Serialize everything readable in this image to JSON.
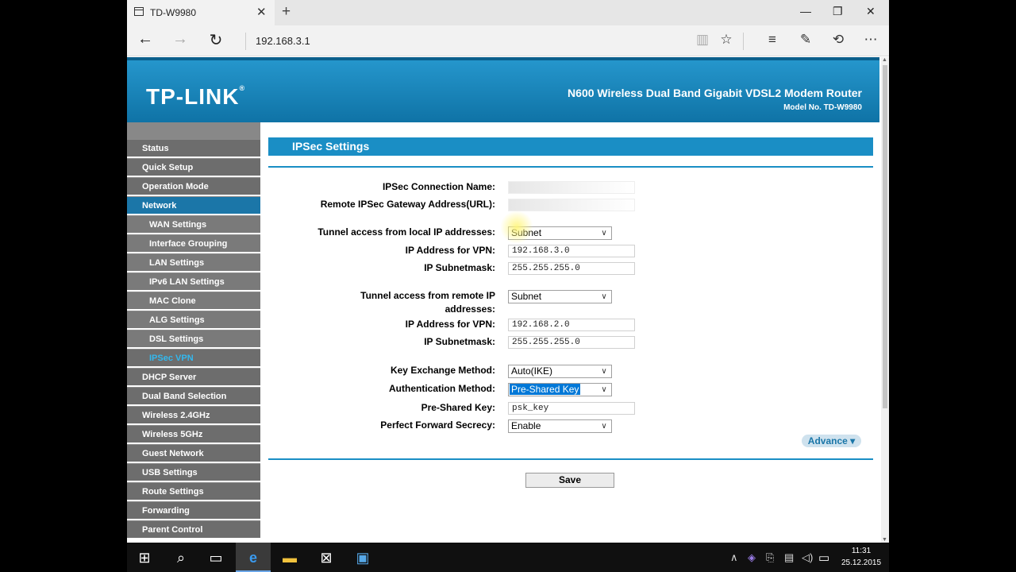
{
  "browser": {
    "tab_title": "TD-W9980",
    "tab_close": "✕",
    "new_tab": "+",
    "url": "192.168.3.1",
    "window_controls": {
      "minimize": "—",
      "maximize": "❐",
      "close": "✕"
    }
  },
  "router": {
    "logo": "TP-LINK",
    "logo_mark": "®",
    "product_name": "N600 Wireless Dual Band Gigabit VDSL2 Modem Router",
    "model": "Model No. TD-W9980"
  },
  "sidebar": {
    "items": [
      {
        "label": "Status"
      },
      {
        "label": "Quick Setup"
      },
      {
        "label": "Operation Mode"
      },
      {
        "label": "Network"
      },
      {
        "label": "WAN Settings"
      },
      {
        "label": "Interface Grouping"
      },
      {
        "label": "LAN Settings"
      },
      {
        "label": "IPv6 LAN Settings"
      },
      {
        "label": "MAC Clone"
      },
      {
        "label": "ALG Settings"
      },
      {
        "label": "DSL Settings"
      },
      {
        "label": "IPSec VPN"
      },
      {
        "label": "DHCP Server"
      },
      {
        "label": "Dual Band Selection"
      },
      {
        "label": "Wireless 2.4GHz"
      },
      {
        "label": "Wireless 5GHz"
      },
      {
        "label": "Guest Network"
      },
      {
        "label": "USB Settings"
      },
      {
        "label": "Route Settings"
      },
      {
        "label": "Forwarding"
      },
      {
        "label": "Parent Control"
      }
    ]
  },
  "form": {
    "title": "IPSec Settings",
    "connection_name_label": "IPSec Connection Name:",
    "connection_name_value": "",
    "remote_gateway_label": "Remote IPSec Gateway Address(URL):",
    "remote_gateway_value": "",
    "local_access_label": "Tunnel access from local IP addresses:",
    "local_access_value": "Subnet",
    "local_ip_label": "IP Address for VPN:",
    "local_ip_value": "192.168.3.0",
    "local_mask_label": "IP Subnetmask:",
    "local_mask_value": "255.255.255.0",
    "remote_access_label_1": "Tunnel access from remote IP",
    "remote_access_label_2": "addresses:",
    "remote_access_value": "Subnet",
    "remote_ip_label": "IP Address for VPN:",
    "remote_ip_value": "192.168.2.0",
    "remote_mask_label": "IP Subnetmask:",
    "remote_mask_value": "255.255.255.0",
    "key_exchange_label": "Key Exchange Method:",
    "key_exchange_value": "Auto(IKE)",
    "auth_method_label": "Authentication Method:",
    "auth_method_value": "Pre-Shared Key",
    "psk_label": "Pre-Shared Key:",
    "psk_value": "psk_key",
    "pfs_label": "Perfect Forward Secrecy:",
    "pfs_value": "Enable",
    "advance_label": "Advance ▾",
    "save_label": "Save"
  },
  "taskbar": {
    "time": "11:31",
    "date": "25.12.2015"
  }
}
